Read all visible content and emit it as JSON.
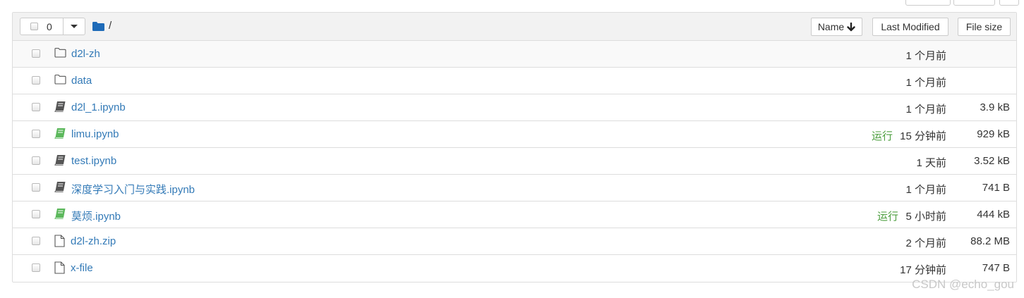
{
  "toolbar": {
    "selected_count": "0",
    "breadcrumb_root": "/",
    "sort_name_label": "Name",
    "sort_modified_label": "Last Modified",
    "sort_size_label": "File size"
  },
  "files": [
    {
      "name": "d2l-zh",
      "type": "folder",
      "running": "",
      "modified": "1 个月前",
      "size": ""
    },
    {
      "name": "data",
      "type": "folder",
      "running": "",
      "modified": "1 个月前",
      "size": ""
    },
    {
      "name": "d2l_1.ipynb",
      "type": "notebook",
      "running": "",
      "modified": "1 个月前",
      "size": "3.9 kB"
    },
    {
      "name": "limu.ipynb",
      "type": "notebook-running",
      "running": "运行",
      "modified": "15 分钟前",
      "size": "929 kB"
    },
    {
      "name": "test.ipynb",
      "type": "notebook",
      "running": "",
      "modified": "1 天前",
      "size": "3.52 kB"
    },
    {
      "name": "深度学习入门与实践.ipynb",
      "type": "notebook",
      "running": "",
      "modified": "1 个月前",
      "size": "741 B"
    },
    {
      "name": "莫烦.ipynb",
      "type": "notebook-running",
      "running": "运行",
      "modified": "5 小时前",
      "size": "444 kB"
    },
    {
      "name": "d2l-zh.zip",
      "type": "file",
      "running": "",
      "modified": "2 个月前",
      "size": "88.2 MB"
    },
    {
      "name": "x-file",
      "type": "file",
      "running": "",
      "modified": "17 分钟前",
      "size": "747 B"
    }
  ],
  "watermark": "CSDN @echo_gou",
  "colors": {
    "link": "#337ab7",
    "running": "#4d9e3f",
    "notebook_icon": "#555555",
    "notebook_running_icon": "#5cb85c",
    "folder_header_icon": "#1e6bb8"
  }
}
